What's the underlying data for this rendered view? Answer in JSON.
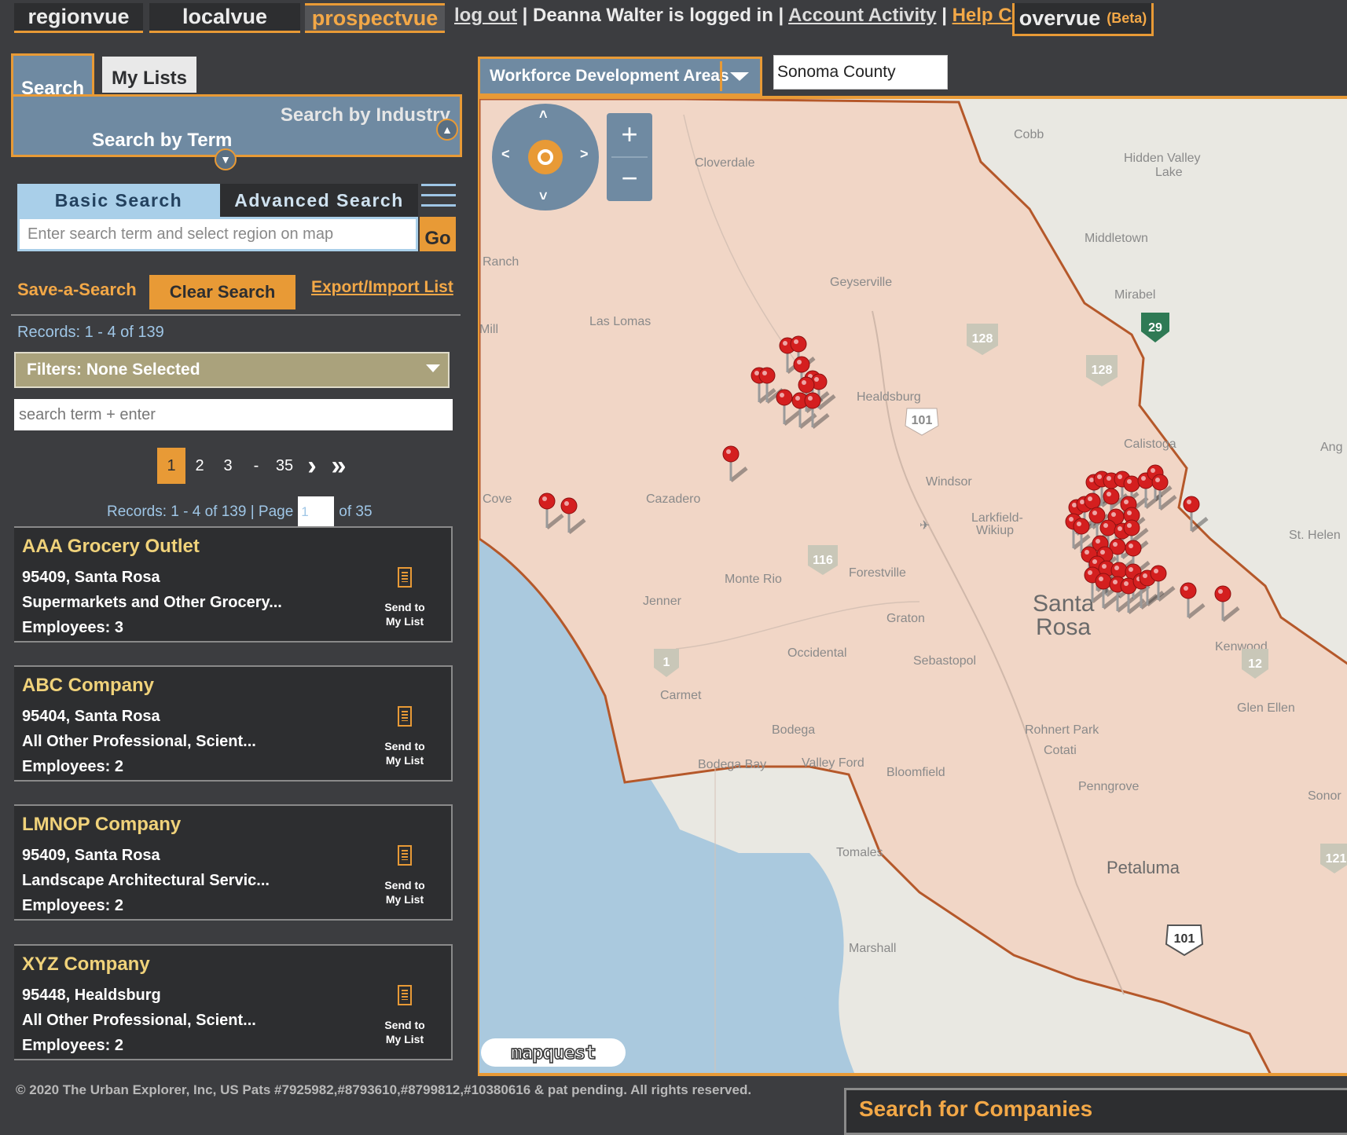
{
  "nav": {
    "tabs": [
      "regionvue",
      "localvue",
      "prospectvue"
    ],
    "active_tab": "prospectvue",
    "logout": "log out",
    "user_status": "Deanna Walter is logged in",
    "account_activity": "Account Activity",
    "help_center": "Help Center",
    "overvue": "overvue",
    "overvue_badge": "(Beta)",
    "sep": "|"
  },
  "search_panel": {
    "tabs": [
      "Search",
      "My Lists"
    ],
    "search_by_industry": "Search by Industry",
    "search_by_term": "Search by Term",
    "basic_search": "Basic Search",
    "advanced_search": "Advanced Search",
    "term_placeholder": "Enter search term and select region on map",
    "go": "Go",
    "save_a_search": "Save-a-Search",
    "clear_search": "Clear Search",
    "export_import": "Export/Import List",
    "records_top": "Records: 1 - 4 of 139",
    "filters": "Filters: None Selected",
    "filter_placeholder": "search term + enter",
    "pager": {
      "pages": [
        "1",
        "2",
        "3",
        "-",
        "35"
      ],
      "current": "1",
      "next": "›",
      "last": "»"
    },
    "records_bottom": "Records: 1 - 4 of 139 | Page",
    "page_value": "1",
    "page_of": "of 35"
  },
  "results": [
    {
      "name": "AAA Grocery Outlet",
      "location": "95409, Santa Rosa",
      "industry": "Supermarkets and Other Grocery...",
      "employees": "Employees: 3"
    },
    {
      "name": "ABC Company",
      "location": "95404, Santa Rosa",
      "industry": "All Other Professional, Scient...",
      "employees": "Employees: 2"
    },
    {
      "name": "LMNOP Company",
      "location": "95409, Santa Rosa",
      "industry": "Landscape Architectural Servic...",
      "employees": "Employees: 2"
    },
    {
      "name": "XYZ Company",
      "location": "95448, Healdsburg",
      "industry": "All Other Professional, Scient...",
      "employees": "Employees: 2"
    }
  ],
  "send_to_list_line1": "Send to",
  "send_to_list_line2": "My List",
  "map": {
    "layer_select": "Workforce Development Areas",
    "region_value": "Sonoma County",
    "zoom_in": "+",
    "zoom_out": "−",
    "attribution": "mapquest",
    "places": {
      "cobb": "Cobb",
      "hidden_valley": "Hidden Valley",
      "lake": "Lake",
      "cloverdale": "Cloverdale",
      "middletown": "Middletown",
      "ranch": "Ranch",
      "geyserville": "Geyserville",
      "mirabel": "Mirabel",
      "mill": "Mill",
      "las_lomas": "Las Lomas",
      "healdsburg": "Healdsburg",
      "calistoga": "Calistoga",
      "ang": "Ang",
      "windsor": "Windsor",
      "cove": "Cove",
      "cazadero": "Cazadero",
      "larkfield": "Larkfield-",
      "wikiup": "Wikiup",
      "st_helena": "St. Helen",
      "monte_rio": "Monte Rio",
      "forestville": "Forestville",
      "jenner": "Jenner",
      "santa": "Santa",
      "rosa": "Rosa",
      "graton": "Graton",
      "kenwood": "Kenwood",
      "occidental": "Occidental",
      "sebastopol": "Sebastopol",
      "carmet": "Carmet",
      "glen_ellen": "Glen Ellen",
      "bodega": "Bodega",
      "rohnert_park": "Rohnert Park",
      "cotati": "Cotati",
      "bodega_bay": "Bodega Bay",
      "valley_ford": "Valley Ford",
      "bloomfield": "Bloomfield",
      "penngrove": "Penngrove",
      "sonoma": "Sonor",
      "tomales": "Tomales",
      "petaluma": "Petaluma",
      "marshall": "Marshall"
    },
    "shields": {
      "r29": "29",
      "r128a": "128",
      "r128b": "128",
      "r101a": "101",
      "r116": "116",
      "r1": "1",
      "r12": "12",
      "r101b": "101",
      "r121": "121"
    }
  },
  "footer": "© 2020 The Urban Explorer, Inc, US Pats #7925982,#8793610,#8799812,#10380616 & pat pending. All rights reserved.",
  "search_for_companies": "Search for Companies",
  "colors": {
    "accent": "#e89a36",
    "panel_blue": "#6f8aa2",
    "background": "#3c3d40",
    "county_fill": "#f1d6c6",
    "county_border": "#b5582a",
    "water": "#aac9de",
    "pin": "#d41f1f"
  }
}
